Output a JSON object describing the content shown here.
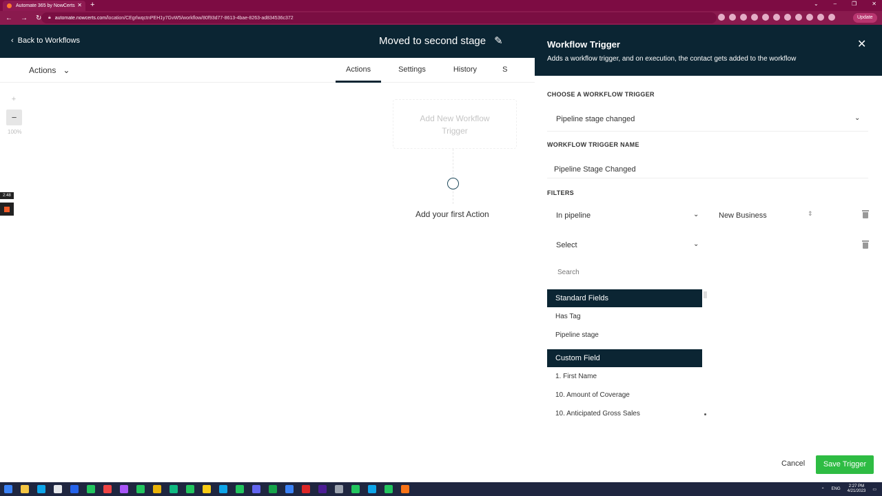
{
  "browser": {
    "tab_title": "Automate 365 by NowCerts",
    "url_host": "automate.nowcerts.com",
    "url_path": "/location/CEgrlwqctnPEH1y7GvW5/workflow/80f93d77-8613-4bae-8263-ad834536c372",
    "update_label": "Update"
  },
  "header": {
    "back_label": "Back to Workflows",
    "workflow_title": "Moved to second stage"
  },
  "subnav": {
    "actions_label": "Actions",
    "tabs": [
      "Actions",
      "Settings",
      "History",
      "S"
    ]
  },
  "canvas": {
    "zoom_plus": "+",
    "zoom_minus": "−",
    "zoom_level": "100%",
    "trigger_placeholder": "Add New Workflow Trigger",
    "add_action_label": "Add your first Action",
    "add_icon": "⊕"
  },
  "recorder": {
    "time": "2:48"
  },
  "panel": {
    "title": "Workflow Trigger",
    "subtitle": "Adds a workflow trigger, and on execution, the contact gets added to the workflow",
    "choose_label": "CHOOSE A WORKFLOW TRIGGER",
    "trigger_value": "Pipeline stage changed",
    "name_label": "WORKFLOW TRIGGER NAME",
    "name_value": "Pipeline Stage Changed",
    "filters_label": "FILTERS",
    "filter1_field": "In pipeline",
    "filter1_value": "New Business",
    "filter2_field": "Select",
    "search_placeholder": "Search",
    "group_standard": "Standard Fields",
    "standard_options": [
      "Has Tag",
      "Pipeline stage"
    ],
    "group_custom": "Custom Field",
    "custom_options": [
      "1. First Name",
      "10. Amount of Coverage",
      "10. Anticipated Gross Sales"
    ],
    "cancel_label": "Cancel",
    "save_label": "Save Trigger"
  },
  "taskbar": {
    "time": "2:27 PM",
    "date": "4/21/2023",
    "lang": "ENG"
  },
  "colors": {
    "header_bg": "#0b2533",
    "browser_bg": "#7d0c43",
    "save_green": "#2ebc43"
  }
}
